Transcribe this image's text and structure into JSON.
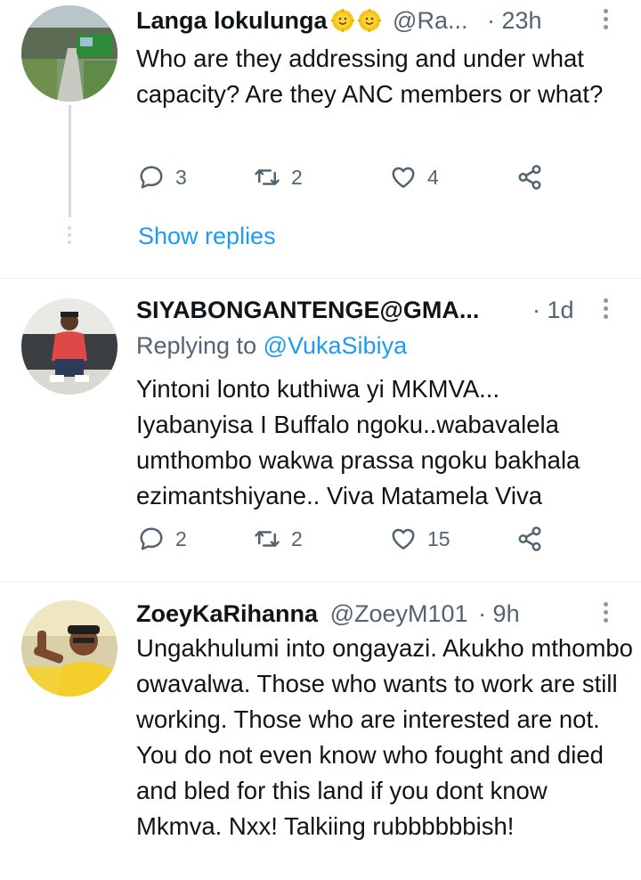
{
  "tweets": [
    {
      "name": "Langa lokulunga",
      "handle": "@Ra...",
      "time": "· 23h",
      "text": "Who are they addressing and under what capacity? Are they ANC members or what?",
      "replies": "3",
      "retweets": "2",
      "likes": "4",
      "show_replies": "Show replies",
      "emojis": [
        "smiley-sun-emoji",
        "smiley-sun-emoji"
      ]
    },
    {
      "name": "SIYABONGANTENGE@GMA...",
      "time": "· 1d",
      "replying_prefix": "Replying to ",
      "replying_to": "@VukaSibiya",
      "text": "Yintoni lonto kuthiwa yi MKMVA...\nIyabanyisa I Buffalo ngoku..wabavalela umthombo wakwa prassa ngoku bakhala ezimantshiyane..  Viva Matamela Viva",
      "replies": "2",
      "retweets": "2",
      "likes": "15"
    },
    {
      "name": "ZoeyKaRihanna",
      "handle": "@ZoeyM101",
      "time": "· 9h",
      "text": "Ungakhulumi into ongayazi. Akukho mthombo owavalwa. Those who wants to work are still working. Those who are interested are not. You do not even know who fought and died and bled for this land if you dont know Mkmva. Nxx! Talkiing rubbbbbbish!"
    }
  ],
  "colors": {
    "accent": "#1d9bf0",
    "secondary_text": "#536471",
    "thread_line": "#cfd9de"
  }
}
